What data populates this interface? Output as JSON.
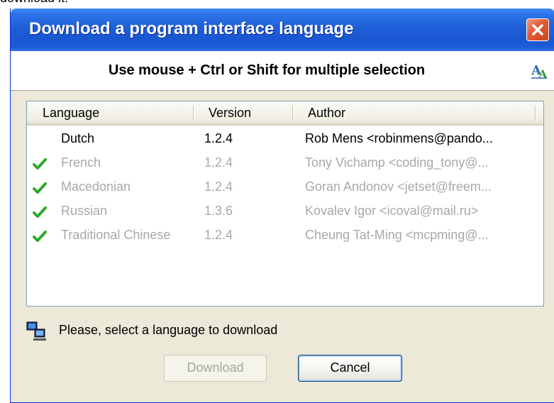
{
  "background_text": "download it.",
  "window": {
    "title": "Download a program interface language",
    "close_icon": "close-icon",
    "instruction": "Use mouse + Ctrl or Shift for multiple selection",
    "header_icon": "language-icon"
  },
  "list": {
    "columns": [
      "Language",
      "Version",
      "Author"
    ],
    "rows": [
      {
        "language": "Dutch",
        "version": "1.2.4",
        "author": "Rob Mens <robinmens@pando...",
        "installed": false
      },
      {
        "language": "French",
        "version": "1.2.4",
        "author": "Tony Vichamp <coding_tony@...",
        "installed": true
      },
      {
        "language": "Macedonian",
        "version": "1.2.4",
        "author": "Goran Andonov <jetset@freem...",
        "installed": true
      },
      {
        "language": "Russian",
        "version": "1.3.6",
        "author": "Kovalev Igor <icoval@mail.ru>",
        "installed": true
      },
      {
        "language": "Traditional Chinese",
        "version": "1.2.4",
        "author": "Cheung Tat-Ming <mcpming@...",
        "installed": true
      }
    ]
  },
  "status": {
    "icon": "computer-network-icon",
    "text": "Please, select a language to download"
  },
  "buttons": {
    "download": "Download",
    "cancel": "Cancel"
  },
  "colors": {
    "titlebar": "#1F5FD9",
    "dialog_bg": "#ECE9D8",
    "disabled_text": "#A8A8A8",
    "check": "#2FA82F"
  }
}
